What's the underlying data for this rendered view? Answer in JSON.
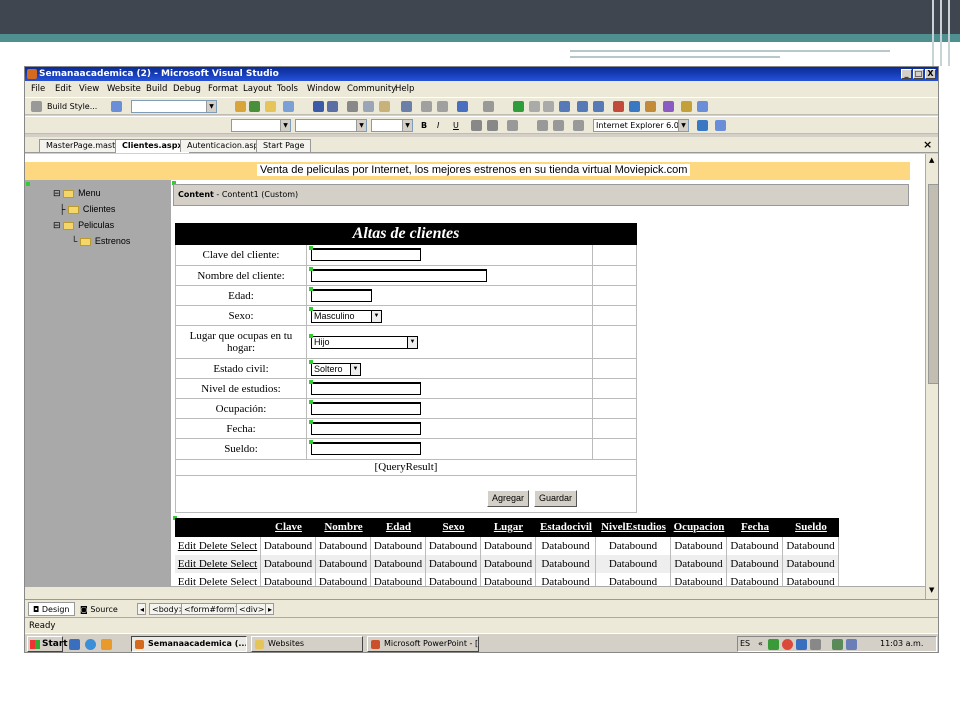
{
  "window": {
    "title": "Semanaacademica (2) - Microsoft Visual Studio",
    "min": "_",
    "max": "□",
    "close": "X"
  },
  "menu": [
    "File",
    "Edit",
    "View",
    "Website",
    "Build",
    "Debug",
    "Format",
    "Layout",
    "Tools",
    "Window",
    "Community",
    "Help"
  ],
  "toolbar": {
    "build_style": "Build Style...",
    "browser_target": "Internet Explorer 6.0",
    "bold": "B",
    "italic": "I",
    "underline": "U"
  },
  "tabs": [
    "MasterPage.master",
    "Clientes.aspx",
    "Autenticacion.aspx",
    "Start Page"
  ],
  "tab_close": "×",
  "banner": "Venta de peliculas por Internet, los mejores estrenos en su tienda virtual Moviepick.com",
  "tree": {
    "root": "Menu",
    "items": [
      "Clientes",
      "Peliculas",
      "Estrenos"
    ]
  },
  "content_header": {
    "prefix": "Content",
    "rest": " - Content1 (Custom)"
  },
  "form": {
    "title": "Altas de clientes",
    "labels": [
      "Clave del cliente:",
      "Nombre del cliente:",
      "Edad:",
      "Sexo:",
      "Lugar que ocupas en tu hogar:",
      "Estado civil:",
      "Nivel de estudios:",
      "Ocupación:",
      "Fecha:",
      "Sueldo:"
    ],
    "sexo": "Masculino",
    "lugar": "Hijo",
    "estado": "Soltero",
    "query_result": "[QueryResult]",
    "agregar": "Agregar",
    "guardar": "Guardar"
  },
  "grid": {
    "headers": [
      "Clave",
      "Nombre",
      "Edad",
      "Sexo",
      "Lugar",
      "Estadocivil",
      "NivelEstudios",
      "Ocupacion",
      "Fecha",
      "Sueldo"
    ],
    "actions": "Edit Delete Select",
    "cell": "Databound"
  },
  "designbar": {
    "design": "Design",
    "source": "Source",
    "crumbs": [
      "<body>",
      "<form#form1>",
      "<div>"
    ]
  },
  "status": "Ready",
  "taskbar": {
    "start": "Start",
    "tasks": [
      "Semanaacademica (...",
      "Websites",
      "Microsoft PowerPoint - [A..."
    ],
    "lang": "ES",
    "time": "11:03 a.m."
  }
}
